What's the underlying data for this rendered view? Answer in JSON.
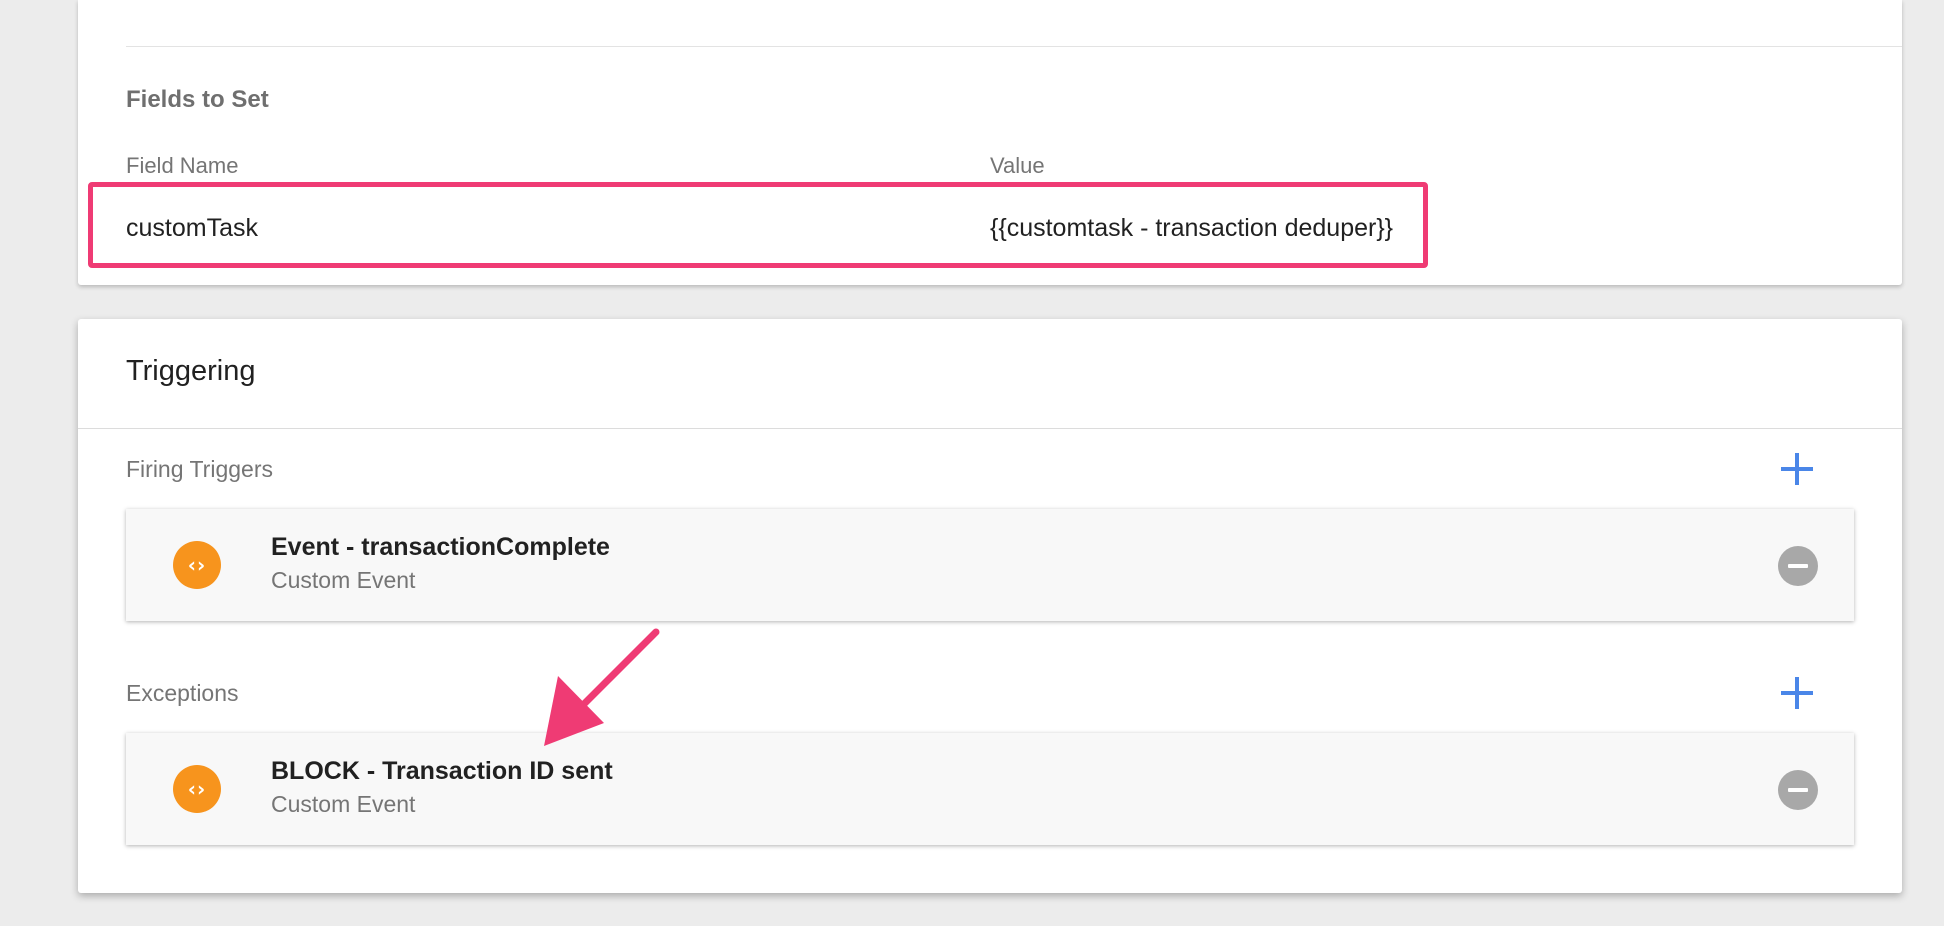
{
  "fields_to_set": {
    "title": "Fields to Set",
    "columns": {
      "name": "Field Name",
      "value": "Value"
    },
    "rows": [
      {
        "name": "customTask",
        "value": "{{customtask - transaction deduper}}"
      }
    ]
  },
  "triggering": {
    "title": "Triggering",
    "firing": {
      "label": "Firing Triggers",
      "items": [
        {
          "icon": "custom-event-icon",
          "icon_glyph": "‹›",
          "name": "Event - transactionComplete",
          "type": "Custom Event"
        }
      ]
    },
    "exceptions": {
      "label": "Exceptions",
      "items": [
        {
          "icon": "custom-event-icon",
          "icon_glyph": "‹›",
          "name": "BLOCK - Transaction ID sent",
          "type": "Custom Event"
        }
      ]
    }
  },
  "colors": {
    "highlight": "#ef3b74",
    "arrow": "#ef3b74",
    "accent_blue": "#4a86e8",
    "trigger_icon": "#f7941d",
    "remove_button": "#a8a8a8"
  }
}
